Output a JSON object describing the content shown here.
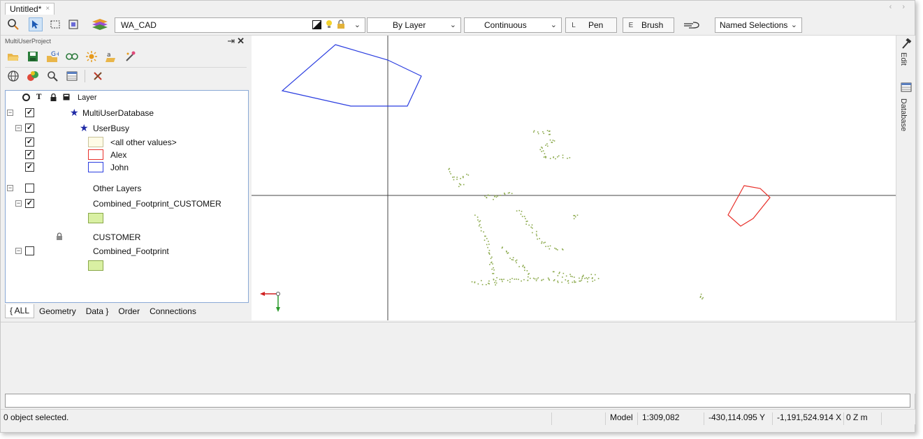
{
  "document_tab": {
    "title": "Untitled*",
    "close": "×"
  },
  "nav_arrows": "‹ ›",
  "toolbar": {
    "layer_combo": "WA_CAD",
    "color_combo": "By Layer",
    "linetype_combo": "Continuous",
    "pen": {
      "key": "L",
      "label": "Pen"
    },
    "brush": {
      "key": "E",
      "label": "Brush"
    },
    "named_selections": "Named Selections"
  },
  "panel": {
    "title": "MultiUserProject",
    "headers": {
      "layer": "Layer"
    },
    "layers": [
      {
        "label": "MultiUserDatabase",
        "checked": true
      },
      {
        "label": "UserBusy",
        "checked": true
      },
      {
        "label": "<all other values>",
        "checked": true,
        "color": "#fffbe6"
      },
      {
        "label": "Alex",
        "checked": true,
        "color": "#e8312b"
      },
      {
        "label": "John",
        "checked": true,
        "color": "#2b3ee0"
      },
      {
        "label": "Other Layers",
        "checked": false
      },
      {
        "label": "Combined_Footprint_CUSTOMER",
        "checked": true,
        "color": "#d9f0a3"
      },
      {
        "label": "CUSTOMER"
      },
      {
        "label": "Combined_Footprint",
        "checked": false,
        "color": "#d9f0a3"
      }
    ],
    "bottom_tabs": [
      "{ ALL",
      "Geometry",
      "Data }",
      "Order",
      "Connections"
    ]
  },
  "right_tabs": [
    "Edit",
    "Database"
  ],
  "status": {
    "selection": "0 object selected.",
    "mode": "Model",
    "scale": "1:309,082",
    "y_coord": "-430,114.095 Y",
    "x_coord": "-1,191,524.914 X",
    "z_units": "0 Z m"
  },
  "colors": {
    "john_polygon": "#2b3ee0",
    "alex_polygon": "#e8312b",
    "footprint_points": "#8aa84a"
  }
}
